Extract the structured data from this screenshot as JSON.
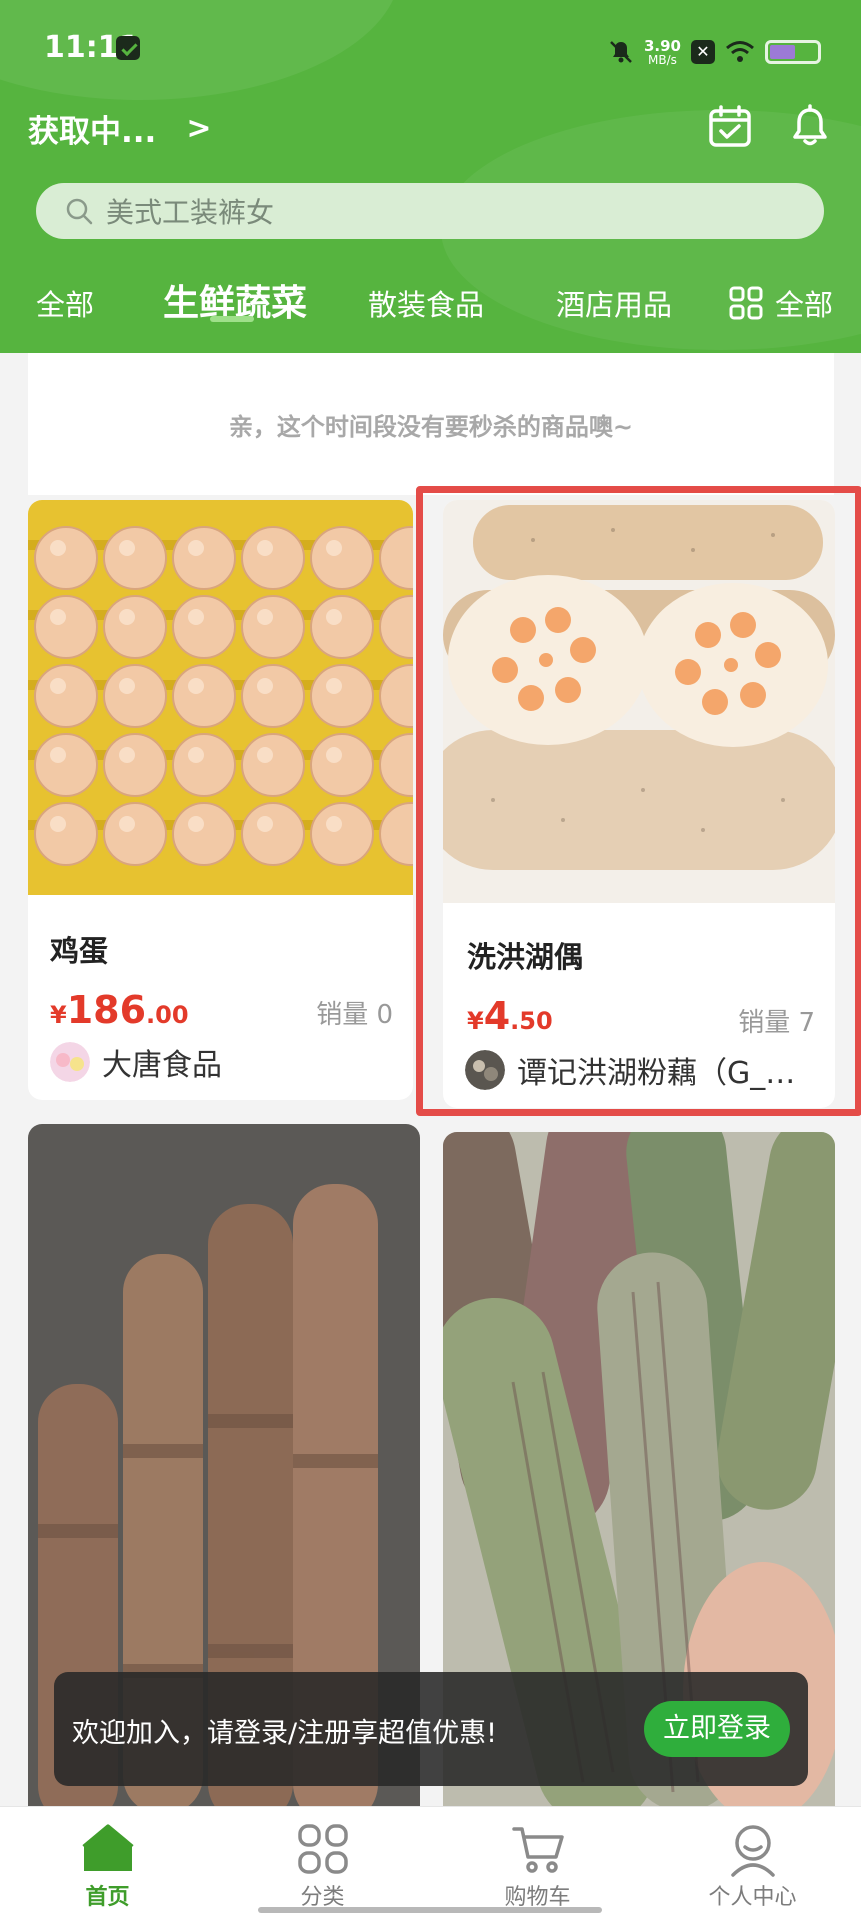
{
  "status_bar": {
    "time": "11:11",
    "network_speed_value": "3.90",
    "network_speed_unit": "MB/s",
    "icons": [
      "message-icon",
      "bell-muted-icon",
      "x-icon",
      "wifi-icon",
      "battery-icon"
    ]
  },
  "header": {
    "location_text": "获取中...",
    "location_chevron": ">",
    "icons": [
      "calendar-check-icon",
      "bell-icon"
    ],
    "search_placeholder": "美式工装裤女",
    "tabs": [
      "全部",
      "生鲜蔬菜",
      "散装食品",
      "酒店用品"
    ],
    "active_tab": "生鲜蔬菜",
    "all_button_label": "全部"
  },
  "seckill_notice": "亲，这个时间段没有要秒杀的商品噢~",
  "products": [
    {
      "title": "鸡蛋",
      "price_symbol": "¥",
      "price_int": "186",
      "price_dec": ".00",
      "sales_label": "销量 0",
      "shop": "大唐食品"
    },
    {
      "title": "洗洪湖偶",
      "price_symbol": "¥",
      "price_int": "4",
      "price_dec": ".50",
      "sales_label": "销量 7",
      "shop": "谭记洪湖粉藕（G_…"
    },
    {
      "title": "",
      "image_subject": "lotus-root-raw"
    },
    {
      "title": "",
      "image_subject": "striped-eggplant"
    }
  ],
  "toast": {
    "message": "欢迎加入，请登录/注册享超值优惠!",
    "button_label": "立即登录"
  },
  "bottom_nav": {
    "items": [
      {
        "label": "首页",
        "icon": "home-icon",
        "active": true
      },
      {
        "label": "分类",
        "icon": "grid-icon",
        "active": false
      },
      {
        "label": "购物车",
        "icon": "cart-icon",
        "active": false
      },
      {
        "label": "个人中心",
        "icon": "user-icon",
        "active": false
      }
    ]
  },
  "colors": {
    "brand_green": "#56b43f",
    "price_red": "#e33a2a",
    "highlight_red": "#e44c48",
    "login_button_green": "#2fae3c"
  }
}
